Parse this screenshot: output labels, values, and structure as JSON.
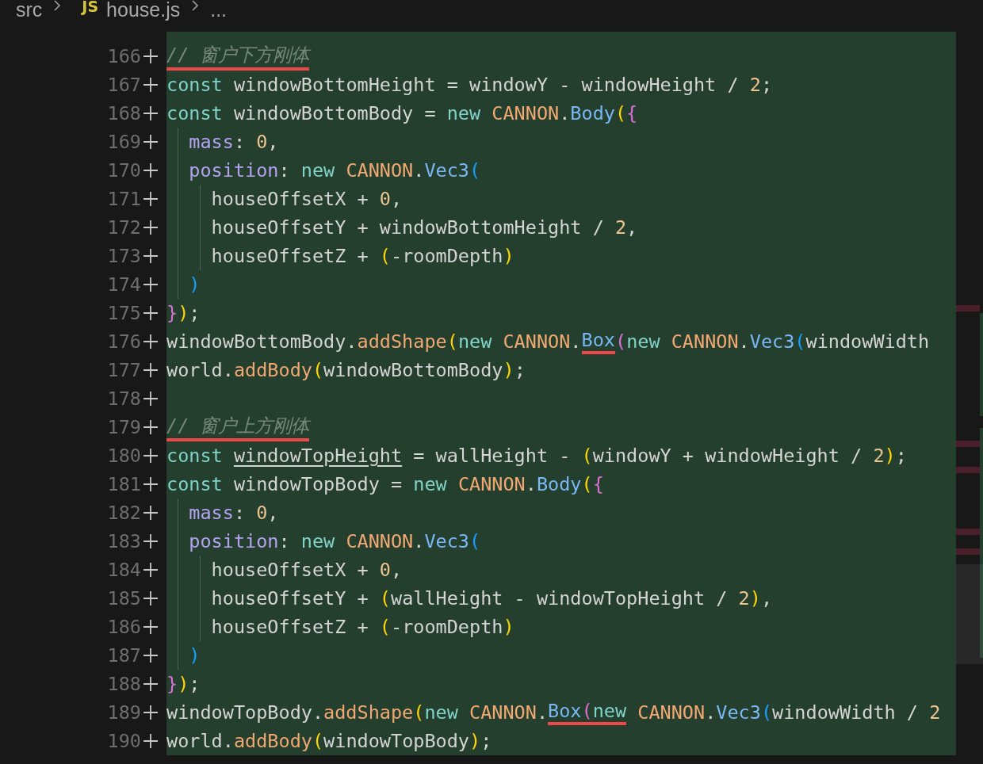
{
  "breadcrumb": {
    "folder": "src",
    "file_icon": "JS",
    "file": "house.js",
    "more": "..."
  },
  "lines": [
    {
      "number": "166",
      "tokens": [
        {
          "text": "// 窗户下方刚体",
          "kind": "comment",
          "mark": true
        }
      ]
    },
    {
      "number": "167",
      "tokens": [
        {
          "text": "const",
          "kind": "keyword"
        },
        {
          "text": " windowBottomHeight = windowY - windowHeight / ",
          "kind": "plain"
        },
        {
          "text": "2",
          "kind": "number"
        },
        {
          "text": ";",
          "kind": "plain"
        }
      ]
    },
    {
      "number": "168",
      "tokens": [
        {
          "text": "const",
          "kind": "keyword"
        },
        {
          "text": " windowBottomBody = ",
          "kind": "plain"
        },
        {
          "text": "new ",
          "kind": "keyword"
        },
        {
          "text": "CANNON",
          "kind": "namespace"
        },
        {
          "text": ".",
          "kind": "plain"
        },
        {
          "text": "Body",
          "kind": "type"
        },
        {
          "text": "(",
          "kind": "bracket1"
        },
        {
          "text": "{",
          "kind": "bracket2"
        }
      ]
    },
    {
      "number": "169",
      "tokens": [
        {
          "text": "  mass",
          "kind": "property"
        },
        {
          "text": ": ",
          "kind": "plain"
        },
        {
          "text": "0",
          "kind": "number"
        },
        {
          "text": ",",
          "kind": "plain"
        }
      ]
    },
    {
      "number": "170",
      "tokens": [
        {
          "text": "  position",
          "kind": "property"
        },
        {
          "text": ": ",
          "kind": "plain"
        },
        {
          "text": "new ",
          "kind": "keyword"
        },
        {
          "text": "CANNON",
          "kind": "namespace"
        },
        {
          "text": ".",
          "kind": "plain"
        },
        {
          "text": "Vec3",
          "kind": "type"
        },
        {
          "text": "(",
          "kind": "bracket3"
        }
      ]
    },
    {
      "number": "171",
      "tokens": [
        {
          "text": "    houseOffsetX + ",
          "kind": "plain"
        },
        {
          "text": "0",
          "kind": "number"
        },
        {
          "text": ",",
          "kind": "plain"
        }
      ]
    },
    {
      "number": "172",
      "tokens": [
        {
          "text": "    houseOffsetY + windowBottomHeight / ",
          "kind": "plain"
        },
        {
          "text": "2",
          "kind": "number"
        },
        {
          "text": ",",
          "kind": "plain"
        }
      ]
    },
    {
      "number": "173",
      "tokens": [
        {
          "text": "    houseOffsetZ + ",
          "kind": "plain"
        },
        {
          "text": "(",
          "kind": "bracket1"
        },
        {
          "text": "-roomDepth",
          "kind": "plain"
        },
        {
          "text": ")",
          "kind": "bracket1"
        }
      ]
    },
    {
      "number": "174",
      "tokens": [
        {
          "text": "  )",
          "kind": "bracket3"
        }
      ]
    },
    {
      "number": "175",
      "tokens": [
        {
          "text": "}",
          "kind": "bracket2"
        },
        {
          "text": ")",
          "kind": "bracket1"
        },
        {
          "text": ";",
          "kind": "plain"
        }
      ]
    },
    {
      "number": "176",
      "tokens": [
        {
          "text": "windowBottomBody.",
          "kind": "plain"
        },
        {
          "text": "addShape",
          "kind": "function"
        },
        {
          "text": "(",
          "kind": "bracket1"
        },
        {
          "text": "new ",
          "kind": "keyword"
        },
        {
          "text": "CANNON",
          "kind": "namespace"
        },
        {
          "text": ".",
          "kind": "plain"
        },
        {
          "text": "Box",
          "kind": "type",
          "mark": true
        },
        {
          "text": "(",
          "kind": "bracket2"
        },
        {
          "text": "new ",
          "kind": "keyword"
        },
        {
          "text": "CANNON",
          "kind": "namespace"
        },
        {
          "text": ".",
          "kind": "plain"
        },
        {
          "text": "Vec3",
          "kind": "type"
        },
        {
          "text": "(",
          "kind": "bracket3"
        },
        {
          "text": "windowWidth",
          "kind": "plain"
        }
      ]
    },
    {
      "number": "177",
      "tokens": [
        {
          "text": "world.",
          "kind": "plain"
        },
        {
          "text": "addBody",
          "kind": "function"
        },
        {
          "text": "(",
          "kind": "bracket1"
        },
        {
          "text": "windowBottomBody",
          "kind": "plain"
        },
        {
          "text": ")",
          "kind": "bracket1"
        },
        {
          "text": ";",
          "kind": "plain"
        }
      ]
    },
    {
      "number": "178"
    },
    {
      "number": "179",
      "tokens": [
        {
          "text": "// 窗户上方刚体",
          "kind": "comment",
          "mark": true
        }
      ]
    },
    {
      "number": "180",
      "tokens": [
        {
          "text": "const ",
          "kind": "keyword"
        },
        {
          "text": "windowTopHeight",
          "kind": "plain",
          "underline": true
        },
        {
          "text": " = wallHeight - ",
          "kind": "plain"
        },
        {
          "text": "(",
          "kind": "bracket1"
        },
        {
          "text": "windowY + windowHeight / ",
          "kind": "plain"
        },
        {
          "text": "2",
          "kind": "number"
        },
        {
          "text": ")",
          "kind": "bracket1"
        },
        {
          "text": ";",
          "kind": "plain"
        }
      ]
    },
    {
      "number": "181",
      "tokens": [
        {
          "text": "const",
          "kind": "keyword"
        },
        {
          "text": " windowTopBody = ",
          "kind": "plain"
        },
        {
          "text": "new ",
          "kind": "keyword"
        },
        {
          "text": "CANNON",
          "kind": "namespace"
        },
        {
          "text": ".",
          "kind": "plain"
        },
        {
          "text": "Body",
          "kind": "type"
        },
        {
          "text": "(",
          "kind": "bracket1"
        },
        {
          "text": "{",
          "kind": "bracket2"
        }
      ]
    },
    {
      "number": "182",
      "tokens": [
        {
          "text": "  mass",
          "kind": "property"
        },
        {
          "text": ": ",
          "kind": "plain"
        },
        {
          "text": "0",
          "kind": "number"
        },
        {
          "text": ",",
          "kind": "plain"
        }
      ]
    },
    {
      "number": "183",
      "tokens": [
        {
          "text": "  position",
          "kind": "property"
        },
        {
          "text": ": ",
          "kind": "plain"
        },
        {
          "text": "new ",
          "kind": "keyword"
        },
        {
          "text": "CANNON",
          "kind": "namespace"
        },
        {
          "text": ".",
          "kind": "plain"
        },
        {
          "text": "Vec3",
          "kind": "type"
        },
        {
          "text": "(",
          "kind": "bracket3"
        }
      ]
    },
    {
      "number": "184",
      "tokens": [
        {
          "text": "    houseOffsetX + ",
          "kind": "plain"
        },
        {
          "text": "0",
          "kind": "number"
        },
        {
          "text": ",",
          "kind": "plain"
        }
      ]
    },
    {
      "number": "185",
      "tokens": [
        {
          "text": "    houseOffsetY + ",
          "kind": "plain"
        },
        {
          "text": "(",
          "kind": "bracket1"
        },
        {
          "text": "wallHeight - windowTopHeight / ",
          "kind": "plain"
        },
        {
          "text": "2",
          "kind": "number"
        },
        {
          "text": ")",
          "kind": "bracket1"
        },
        {
          "text": ",",
          "kind": "plain"
        }
      ]
    },
    {
      "number": "186",
      "tokens": [
        {
          "text": "    houseOffsetZ + ",
          "kind": "plain"
        },
        {
          "text": "(",
          "kind": "bracket1"
        },
        {
          "text": "-roomDepth",
          "kind": "plain"
        },
        {
          "text": ")",
          "kind": "bracket1"
        }
      ]
    },
    {
      "number": "187",
      "tokens": [
        {
          "text": "  )",
          "kind": "bracket3"
        }
      ]
    },
    {
      "number": "188",
      "tokens": [
        {
          "text": "}",
          "kind": "bracket2"
        },
        {
          "text": ")",
          "kind": "bracket1"
        },
        {
          "text": ";",
          "kind": "plain"
        }
      ]
    },
    {
      "number": "189",
      "tokens": [
        {
          "text": "windowTopBody.",
          "kind": "plain"
        },
        {
          "text": "addShape",
          "kind": "function"
        },
        {
          "text": "(",
          "kind": "bracket1"
        },
        {
          "text": "new ",
          "kind": "keyword"
        },
        {
          "text": "CANNON",
          "kind": "namespace"
        },
        {
          "text": ".",
          "kind": "plain"
        },
        {
          "text": "Box",
          "kind": "type",
          "mark": true
        },
        {
          "text": "(",
          "kind": "bracket2",
          "mark": true
        },
        {
          "text": "new",
          "kind": "keyword",
          "mark": true
        },
        {
          "text": " CANNON",
          "kind": "namespace"
        },
        {
          "text": ".",
          "kind": "plain"
        },
        {
          "text": "Vec3",
          "kind": "type"
        },
        {
          "text": "(",
          "kind": "bracket3"
        },
        {
          "text": "windowWidth / ",
          "kind": "plain"
        },
        {
          "text": "2",
          "kind": "number"
        }
      ]
    },
    {
      "number": "190",
      "tokens": [
        {
          "text": "world.",
          "kind": "plain"
        },
        {
          "text": "addBody",
          "kind": "function"
        },
        {
          "text": "(",
          "kind": "bracket1"
        },
        {
          "text": "windowTopBody",
          "kind": "plain"
        },
        {
          "text": ")",
          "kind": "bracket1"
        },
        {
          "text": ";",
          "kind": "plain"
        }
      ]
    }
  ]
}
